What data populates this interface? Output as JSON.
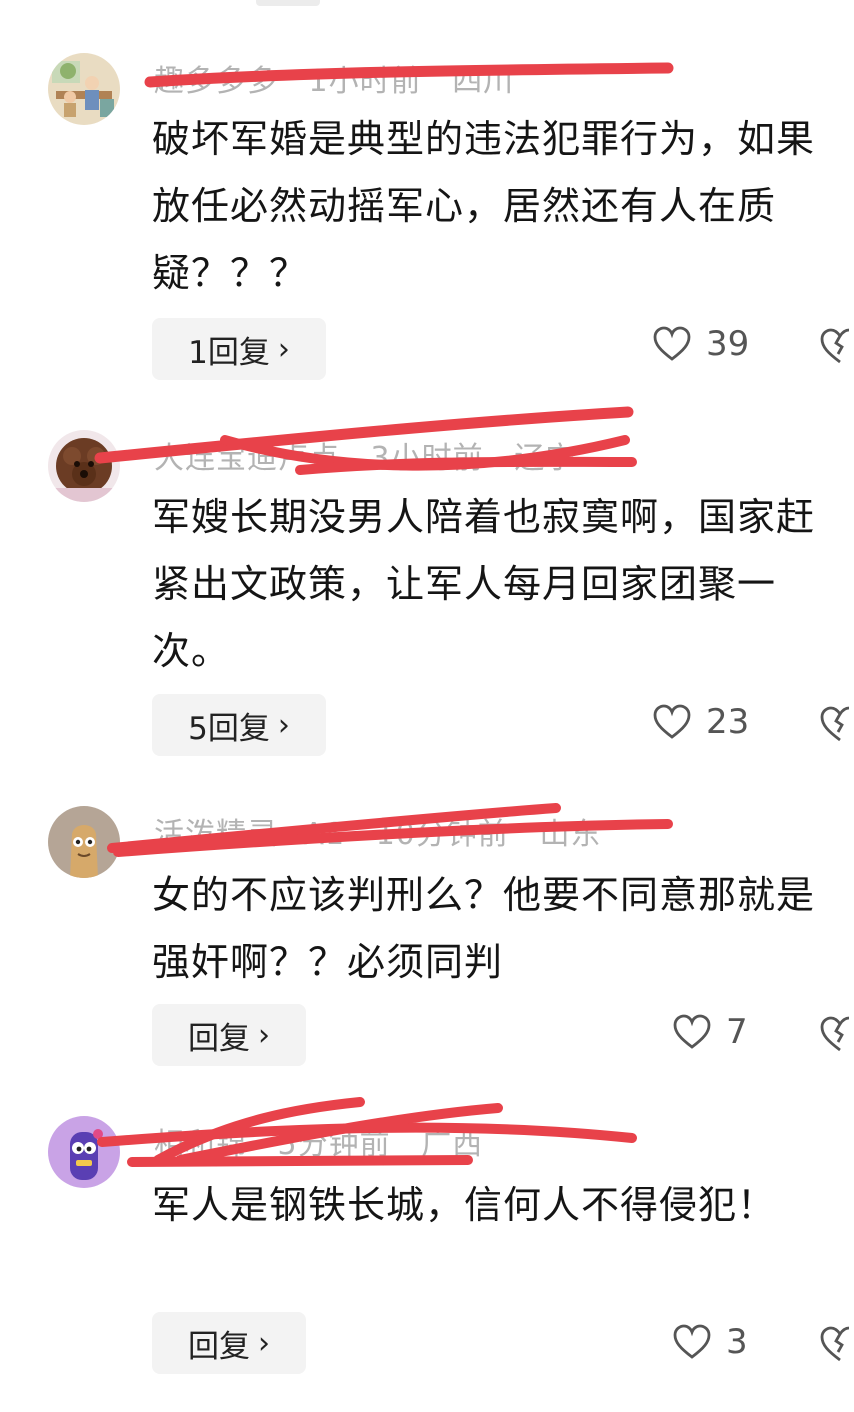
{
  "comments": [
    {
      "user": "趣多多多",
      "time": "1小时前",
      "location": "四川",
      "text": "破坏军婚是典型的违法犯罪行为，如果放任必然动摇军心，居然还有人在质疑？？？",
      "replies": "1回复",
      "likes": "39"
    },
    {
      "user": "大连宝迪卢点",
      "time": "3小时前",
      "location": "辽宁",
      "text": "军嫂长期没男人陪着也寂寞啊，国家赶紧出文政策，让军人每月回家团聚一次。",
      "replies": "5回复",
      "likes": "23"
    },
    {
      "user": "活泼精灵wA1",
      "time": "10分钟前",
      "location": "山东",
      "text": "女的不应该判刑么？他要不同意那就是强奸啊？？必须同判",
      "replies": "回复",
      "likes": "7"
    },
    {
      "user": "相和锦",
      "time": "5分钟前",
      "location": "广西",
      "text": "军人是钢铁长城，信何人不得侵犯！",
      "replies": "回复",
      "likes": "3"
    }
  ],
  "colors": {
    "scribble": "#e8424a",
    "meta": "#b3b3b3",
    "reply_bg": "#f3f3f3"
  },
  "icons": {
    "like": "heart-outline-icon",
    "dislike": "broken-heart-outline-icon",
    "chevron": "chevron-right-icon"
  }
}
